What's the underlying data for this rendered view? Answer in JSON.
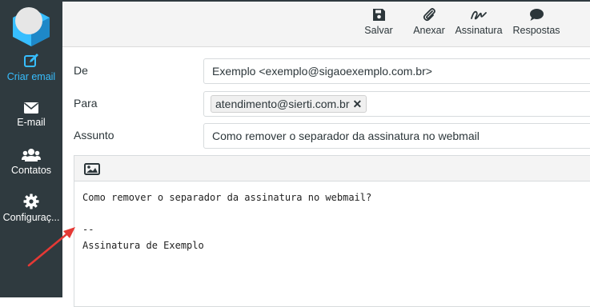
{
  "sidebar": {
    "items": [
      {
        "label": "Criar email",
        "icon": "compose-icon"
      },
      {
        "label": "E-mail",
        "icon": "envelope-icon"
      },
      {
        "label": "Contatos",
        "icon": "users-icon"
      },
      {
        "label": "Configuraç...",
        "icon": "gear-icon"
      }
    ]
  },
  "toolbar": {
    "save": "Salvar",
    "attach": "Anexar",
    "signature": "Assinatura",
    "responses": "Respostas"
  },
  "form": {
    "from_label": "De",
    "from_value": "Exemplo <exemplo@sigaoexemplo.com.br>",
    "to_label": "Para",
    "to_recipient": "atendimento@sierti.com.br",
    "subject_label": "Assunto",
    "subject_value": "Como remover o separador da assinatura no webmail"
  },
  "editor": {
    "line1": "Como remover o separador da assinatura no webmail?",
    "separator": "--",
    "signature": "Assinatura de Exemplo"
  },
  "colors": {
    "sidebar_bg": "#2f3a3f",
    "active": "#37beff",
    "arrow": "#e53935"
  }
}
